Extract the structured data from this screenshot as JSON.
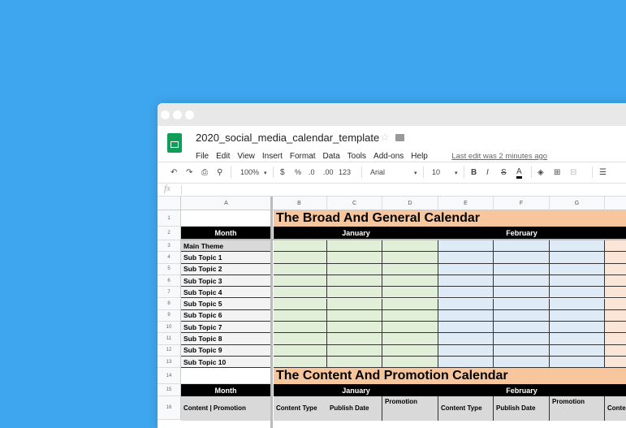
{
  "document": {
    "title": "2020_social_media_calendar_template",
    "last_edit": "Last edit was 2 minutes ago"
  },
  "menu": [
    "File",
    "Edit",
    "View",
    "Insert",
    "Format",
    "Data",
    "Tools",
    "Add-ons",
    "Help"
  ],
  "toolbar": {
    "zoom": "100%",
    "currency": "$",
    "percent": "%",
    "dec_decrease": ".0",
    "dec_increase": ".00",
    "format": "123",
    "font": "Arial",
    "size": "10",
    "bold": "B",
    "italic": "I",
    "strike": "S",
    "text_color": "A"
  },
  "formula_bar": {
    "label": "fx",
    "value": ""
  },
  "columns": [
    "A",
    "B",
    "C",
    "D",
    "E",
    "F",
    "G"
  ],
  "rows": [
    "1",
    "2",
    "3",
    "4",
    "5",
    "6",
    "7",
    "8",
    "9",
    "10",
    "11",
    "12",
    "13",
    "14",
    "15",
    "16"
  ],
  "sheet": {
    "title1": "The Broad And General Calendar",
    "title2": "The Content And Promotion Calendar",
    "month_label": "Month",
    "months": [
      "January",
      "February"
    ],
    "topics": [
      "Main Theme",
      "Sub Topic 1",
      "Sub Topic 2",
      "Sub Topic 3",
      "Sub Topic 4",
      "Sub Topic 5",
      "Sub Topic 6",
      "Sub Topic 7",
      "Sub Topic 8",
      "Sub Topic 9",
      "Sub Topic 10"
    ],
    "row16_a": "Content | Promotion",
    "row16_headers": [
      "Content Type",
      "Publish Date",
      "Promotion",
      "Content Type",
      "Publish Date",
      "Promotion",
      "Conte"
    ]
  },
  "colors": {
    "background": "#3ea6ee",
    "title_fill": "#f7c69c",
    "january_fill": "#e1efd9",
    "february_fill": "#deeaf6",
    "march_fill": "#fbe5d6",
    "header_fill": "#000000",
    "sheets_green": "#0f9d58"
  }
}
